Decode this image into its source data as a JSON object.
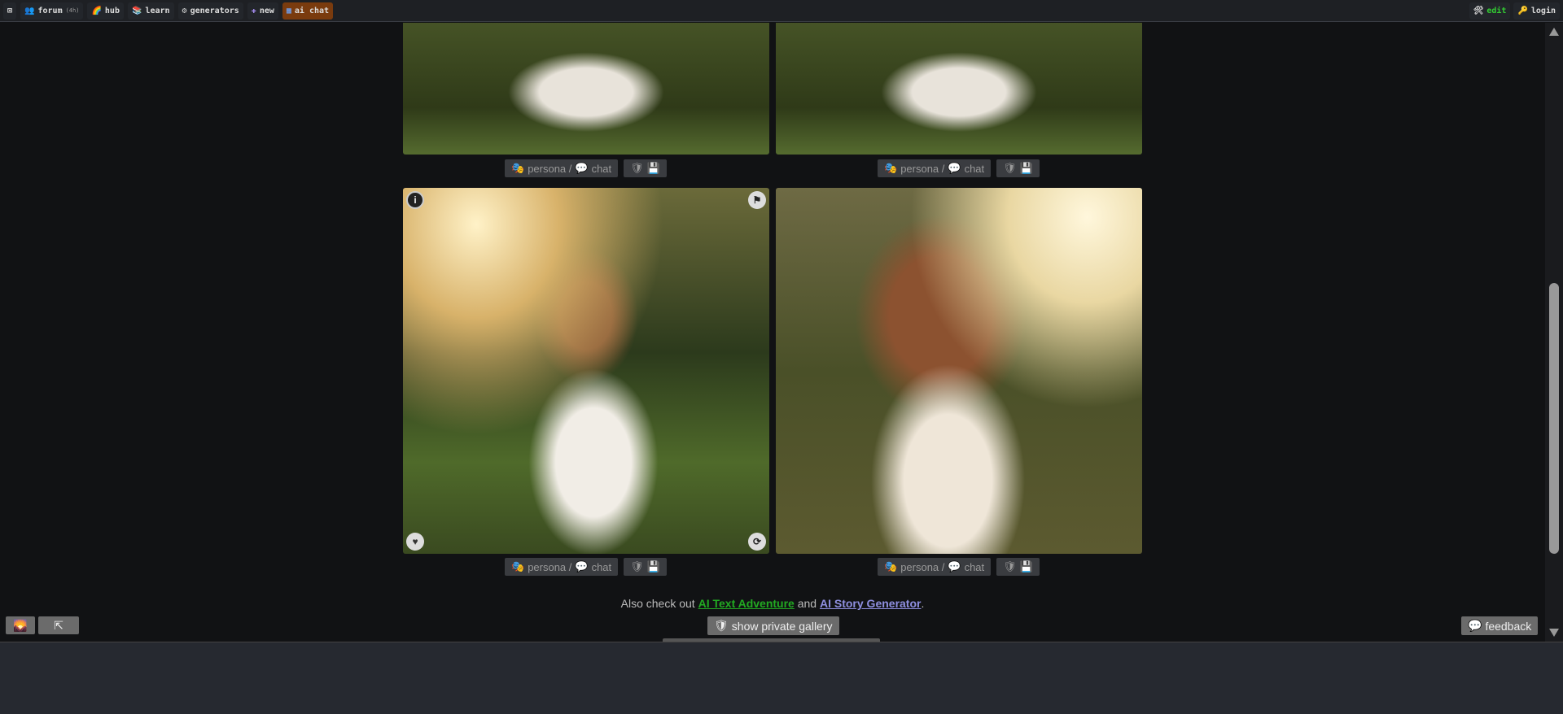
{
  "nav": {
    "items": [
      {
        "icon": "close-box",
        "label": ""
      },
      {
        "icon": "people",
        "label": "forum",
        "badge": "(4h)"
      },
      {
        "icon": "rainbow",
        "label": "hub"
      },
      {
        "icon": "books",
        "label": "learn"
      },
      {
        "icon": "gears",
        "label": "generators"
      },
      {
        "icon": "plus",
        "label": "new"
      },
      {
        "icon": "chat-window",
        "label": "ai chat"
      }
    ],
    "edit": "edit",
    "login": "login"
  },
  "gallery": {
    "persona_label": "persona /",
    "chat_label": "chat"
  },
  "footer": {
    "also_prefix": "Also check out",
    "link1": "AI Text Adventure",
    "and": "and",
    "link2": "AI Story Generator",
    "period": ".",
    "private_gallery": "show private gallery",
    "feedback": "feedback"
  },
  "colors": {
    "link1": "#22aa22",
    "link2": "#8f8fe0",
    "active_tab": "#7a3b0e"
  }
}
